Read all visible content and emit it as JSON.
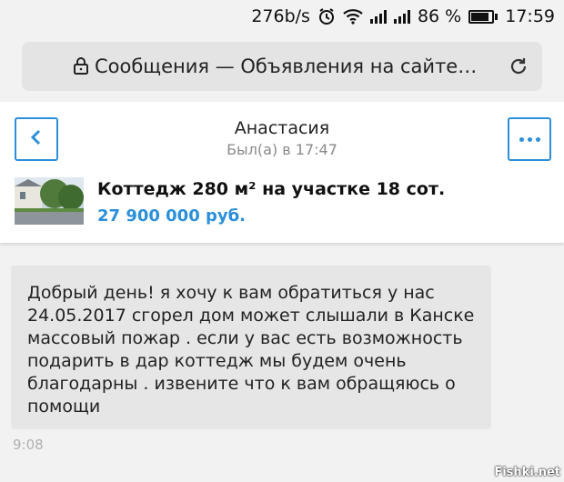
{
  "status_bar": {
    "net_speed": "276b/s",
    "battery_percent": "86 %",
    "battery_level": 0.86,
    "time": "17:59",
    "icons": [
      "alarm-icon",
      "wifi-icon",
      "signal-icon",
      "signal-icon",
      "battery-icon"
    ]
  },
  "browser": {
    "address_text": "Сообщения — Объявления на сайте…",
    "icons": [
      "lock-icon",
      "reload-icon"
    ]
  },
  "chat": {
    "contact_name": "Анастасия",
    "last_seen": "Был(а) в 17:47",
    "listing": {
      "title": "Коттедж 280 м² на участке 18 сот.",
      "price": "27 900 000 руб."
    },
    "messages": [
      {
        "text": "Добрый день! я хочу к вам обратиться у нас 24.05.2017 сгорел дом может слышали в Канске массовый пожар . если у вас есть возможность подарить в дар коттедж мы будем очень благодарны . извените что к вам обращяюсь о помощи",
        "time": "9:08"
      }
    ]
  },
  "watermark": "Fishki.net",
  "colors": {
    "accent": "#2b8fd9",
    "bubble": "#e6e6e6",
    "background": "#f2f2f2"
  }
}
